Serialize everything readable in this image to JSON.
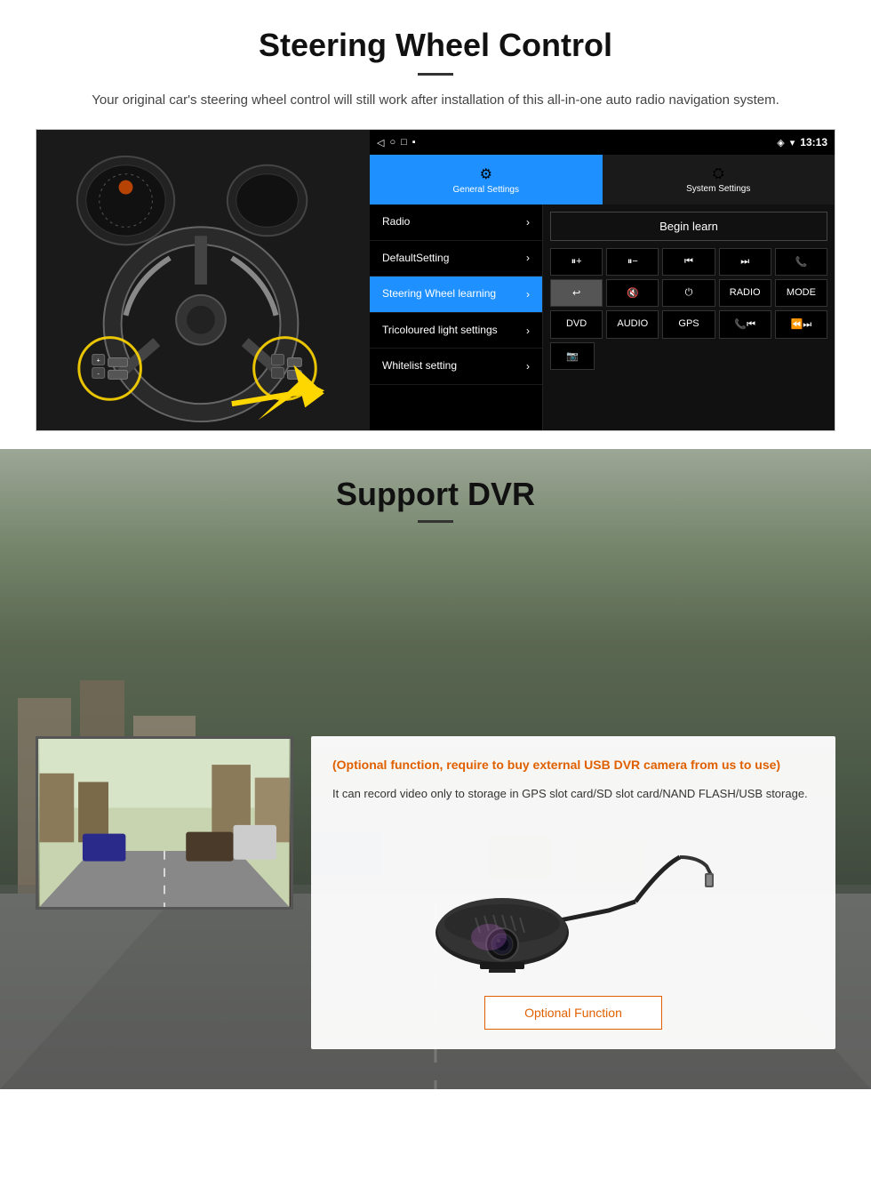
{
  "steering": {
    "title": "Steering Wheel Control",
    "subtitle": "Your original car's steering wheel control will still work after installation of this all-in-one auto radio navigation system.",
    "android": {
      "status_bar": {
        "time": "13:13",
        "icons": [
          "signal",
          "wifi",
          "battery"
        ]
      },
      "tabs": [
        {
          "label": "General Settings",
          "icon": "⚙"
        },
        {
          "label": "System Settings",
          "icon": "🔧"
        }
      ],
      "menu_items": [
        {
          "label": "Radio",
          "active": false
        },
        {
          "label": "DefaultSetting",
          "active": false
        },
        {
          "label": "Steering Wheel learning",
          "active": true
        },
        {
          "label": "Tricoloured light settings",
          "active": false
        },
        {
          "label": "Whitelist setting",
          "active": false
        }
      ],
      "begin_learn": "Begin learn",
      "control_buttons": [
        [
          "Vol+",
          "Vol-",
          "⏮",
          "⏭",
          "📞"
        ],
        [
          "↩",
          "🔇x",
          "⏻",
          "RADIO",
          "MODE"
        ],
        [
          "DVD",
          "AUDIO",
          "GPS",
          "📞⏮",
          "⏪⏭"
        ],
        [
          "📷"
        ]
      ]
    }
  },
  "dvr": {
    "title": "Support DVR",
    "orange_text": "(Optional function, require to buy external USB DVR camera from us to use)",
    "description": "It can record video only to storage in GPS slot card/SD slot card/NAND FLASH/USB storage.",
    "optional_button": "Optional Function"
  }
}
